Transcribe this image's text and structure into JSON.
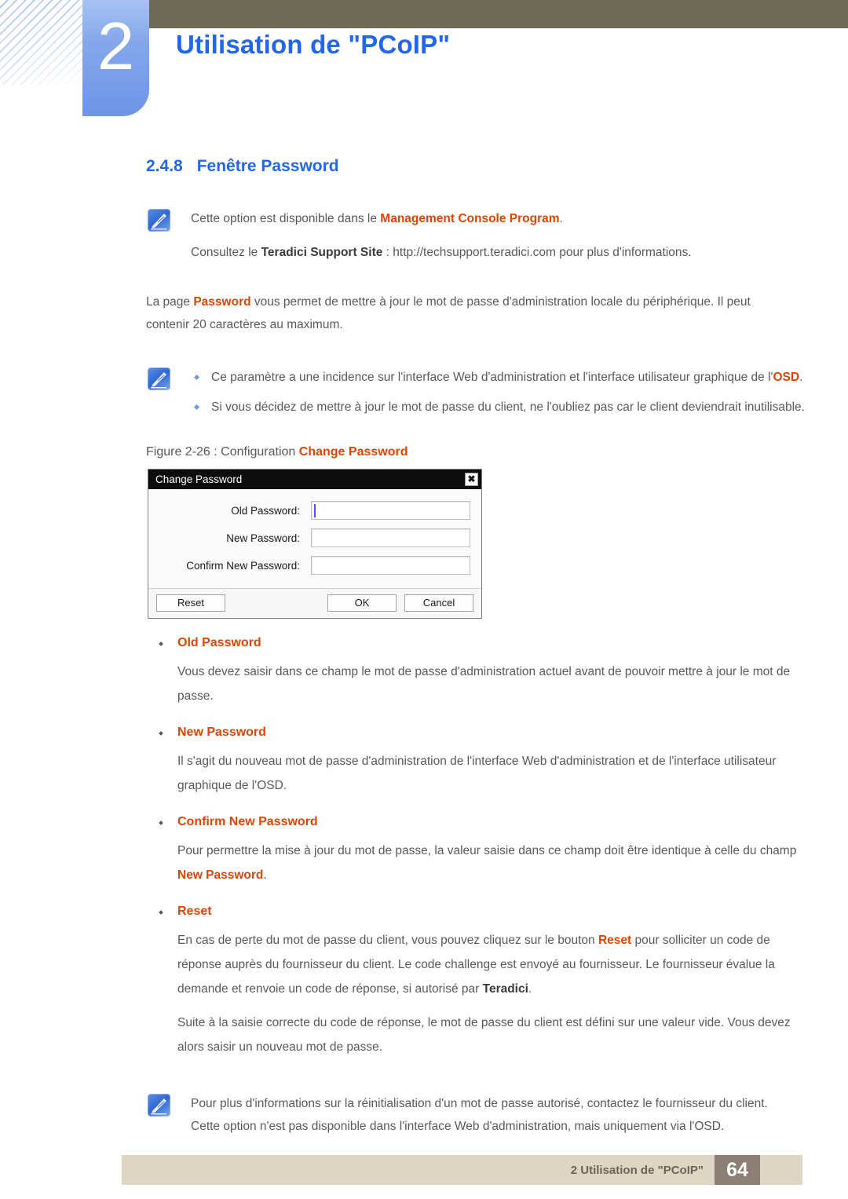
{
  "header": {
    "chapter_number": "2",
    "chapter_title": "Utilisation de \"PCoIP\""
  },
  "section": {
    "number": "2.4.8",
    "title": "Fenêtre Password"
  },
  "note_top": {
    "icon": "note-pen-icon",
    "line1_pre": "Cette option est disponible dans le ",
    "line1_highlight": "Management Console Program",
    "line1_post": ".",
    "line2_pre": "Consultez le ",
    "line2_bold": "Teradici Support Site",
    "line2_post": " : http://techsupport.teradici.com pour plus d'informations."
  },
  "intro": {
    "pre": "La page ",
    "highlight": "Password",
    "post": " vous permet de mettre à jour le mot de passe d'administration locale du périphérique. Il peut contenir 20 caractères au maximum."
  },
  "note_bullets": {
    "icon": "note-pen-icon",
    "item1_pre": "Ce paramètre a une incidence sur l'interface Web d'administration et l'interface utilisateur graphique de l'",
    "item1_highlight": "OSD",
    "item1_post": ".",
    "item2": "Si vous décidez de mettre à jour le mot de passe du client, ne l'oubliez pas car le client deviendrait inutilisable."
  },
  "figure": {
    "caption_pre": "Figure 2-26 : Configuration ",
    "caption_highlight": "Change Password"
  },
  "dialog": {
    "title": "Change Password",
    "close_icon": "close-icon",
    "fields": [
      {
        "label": "Old Password:",
        "value": "",
        "focused": true
      },
      {
        "label": "New Password:",
        "value": "",
        "focused": false
      },
      {
        "label": "Confirm New Password:",
        "value": "",
        "focused": false
      }
    ],
    "buttons": {
      "reset": "Reset",
      "ok": "OK",
      "cancel": "Cancel"
    }
  },
  "terms": [
    {
      "name": "Old Password",
      "paragraphs": [
        {
          "text": "Vous devez saisir dans ce champ le mot de passe d'administration actuel avant de pouvoir mettre à jour le mot de passe."
        }
      ]
    },
    {
      "name": "New Password",
      "paragraphs": [
        {
          "text": "Il s'agit du nouveau mot de passe d'administration de l'interface Web d'administration et de l'interface utilisateur graphique de l'OSD."
        }
      ]
    },
    {
      "name": "Confirm New Password",
      "paragraphs": [
        {
          "pre": "Pour permettre la mise à jour du mot de passe, la valeur saisie dans ce champ doit être identique à celle du champ ",
          "highlight": "New Password",
          "post": "."
        }
      ]
    },
    {
      "name": "Reset",
      "paragraphs": [
        {
          "pre": "En cas de perte du mot de passe du client, vous pouvez cliquez sur le bouton ",
          "highlight": "Reset",
          "mid": " pour solliciter un code de réponse auprès du fournisseur du client. Le code challenge est envoyé au fournisseur. Le fournisseur évalue la demande et renvoie un code de réponse, si autorisé par ",
          "bold": "Teradici",
          "post": "."
        },
        {
          "text": "Suite à la saisie correcte du code de réponse, le mot de passe du client est défini sur une valeur vide. Vous devez alors saisir un nouveau mot de passe."
        }
      ]
    }
  ],
  "note_bottom": {
    "icon": "note-pen-icon",
    "text": "Pour plus d'informations sur la réinitialisation d'un mot de passe autorisé, contactez le fournisseur du client. Cette option n'est pas disponible dans l'interface Web d'administration, mais uniquement via l'OSD."
  },
  "footer": {
    "text": "2 Utilisation de \"PCoIP\"",
    "page_number": "64"
  },
  "colors": {
    "accent_blue": "#2266ee",
    "highlight_orange": "#e04403",
    "header_olive": "#6e6a54",
    "footer_beige": "#ded5c2",
    "footer_page_brown": "#8c7f74",
    "body_gray": "#59595b"
  }
}
